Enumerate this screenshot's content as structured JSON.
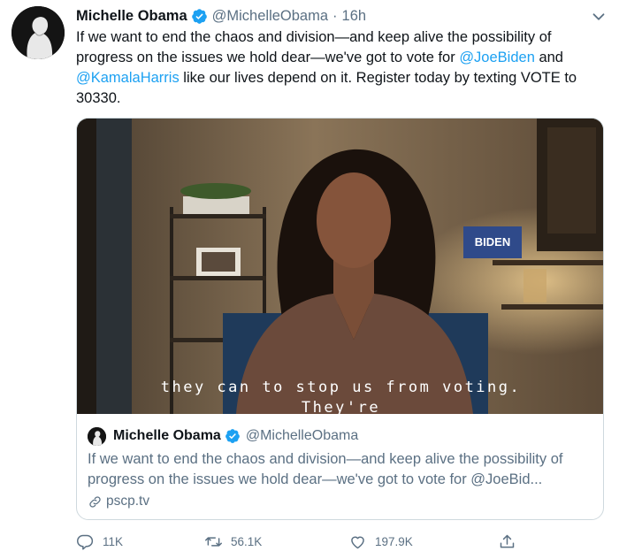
{
  "author": {
    "name": "Michelle Obama",
    "handle": "@MichelleObama",
    "separator": "·",
    "time": "16h"
  },
  "tweet": {
    "text_part1": "If we want to end the chaos and division—and keep alive the possibility of progress on the issues we hold dear—we've got to vote for ",
    "mention1": "@JoeBiden",
    "text_part2": " and ",
    "mention2": "@KamalaHarris",
    "text_part3": " like our lives depend on it. Register today by texting VOTE to 30330."
  },
  "video": {
    "caption_line1": "they can to stop us from voting.",
    "caption_line2": "They're",
    "sign_text": "BIDEN"
  },
  "card": {
    "author_name": "Michelle Obama",
    "author_handle": "@MichelleObama",
    "text": "If we want to end the chaos and division—and keep alive the possibility of progress on the issues we hold dear—we've got to vote for @JoeBid...",
    "link": "pscp.tv"
  },
  "actions": {
    "replies": "11K",
    "retweets": "56.1K",
    "likes": "197.9K"
  },
  "icons": {
    "verified": "verified-badge-icon",
    "caret": "chevron-down-icon",
    "reply": "reply-icon",
    "retweet": "retweet-icon",
    "like": "heart-icon",
    "share": "share-icon",
    "link": "link-icon"
  },
  "colors": {
    "accent": "#1da1f2",
    "secondary_text": "#5b7083",
    "border": "#cfd9de"
  }
}
